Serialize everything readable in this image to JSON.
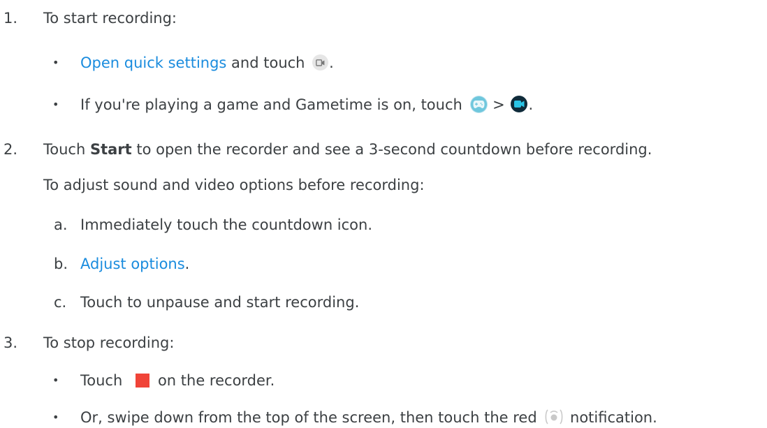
{
  "steps": {
    "s1": {
      "number": "1.",
      "text": "To start recording:",
      "b1": {
        "bullet": "•",
        "link": "Open quick settings",
        "after_link": " and touch ",
        "end": "."
      },
      "b2": {
        "bullet": "•",
        "text": "If you're playing a game and Gametime is on, touch ",
        "sep": " > ",
        "end": "."
      }
    },
    "s2": {
      "number": "2.",
      "pre": "Touch ",
      "bold": "Start",
      "post": " to open the recorder and see a 3-second countdown before recording.",
      "note": "To adjust sound and video options before recording:",
      "a": {
        "letter": "a.",
        "text": "Immediately touch the countdown icon."
      },
      "b": {
        "letter": "b.",
        "link": "Adjust options",
        "end": "."
      },
      "c": {
        "letter": "c.",
        "text": "Touch to unpause and start recording."
      }
    },
    "s3": {
      "number": "3.",
      "text": "To stop recording:",
      "b1": {
        "bullet": "•",
        "pre": "Touch ",
        "post": "on the recorder."
      },
      "b2": {
        "bullet": "•",
        "pre": "Or, swipe down from the top of the screen, then touch the red ",
        "post": " notification."
      }
    }
  },
  "icons": {
    "screen_record": "screen-record-icon",
    "gametime": "gametime-icon",
    "camera": "video-camera-icon",
    "stop": "stop-icon",
    "recording_notification": "recording-notification-icon"
  },
  "colors": {
    "text": "#3c4043",
    "link": "#1a8cde",
    "stop": "#f04438",
    "gametime": "#6fc7dd",
    "camera_bg": "#0f2b3a"
  }
}
